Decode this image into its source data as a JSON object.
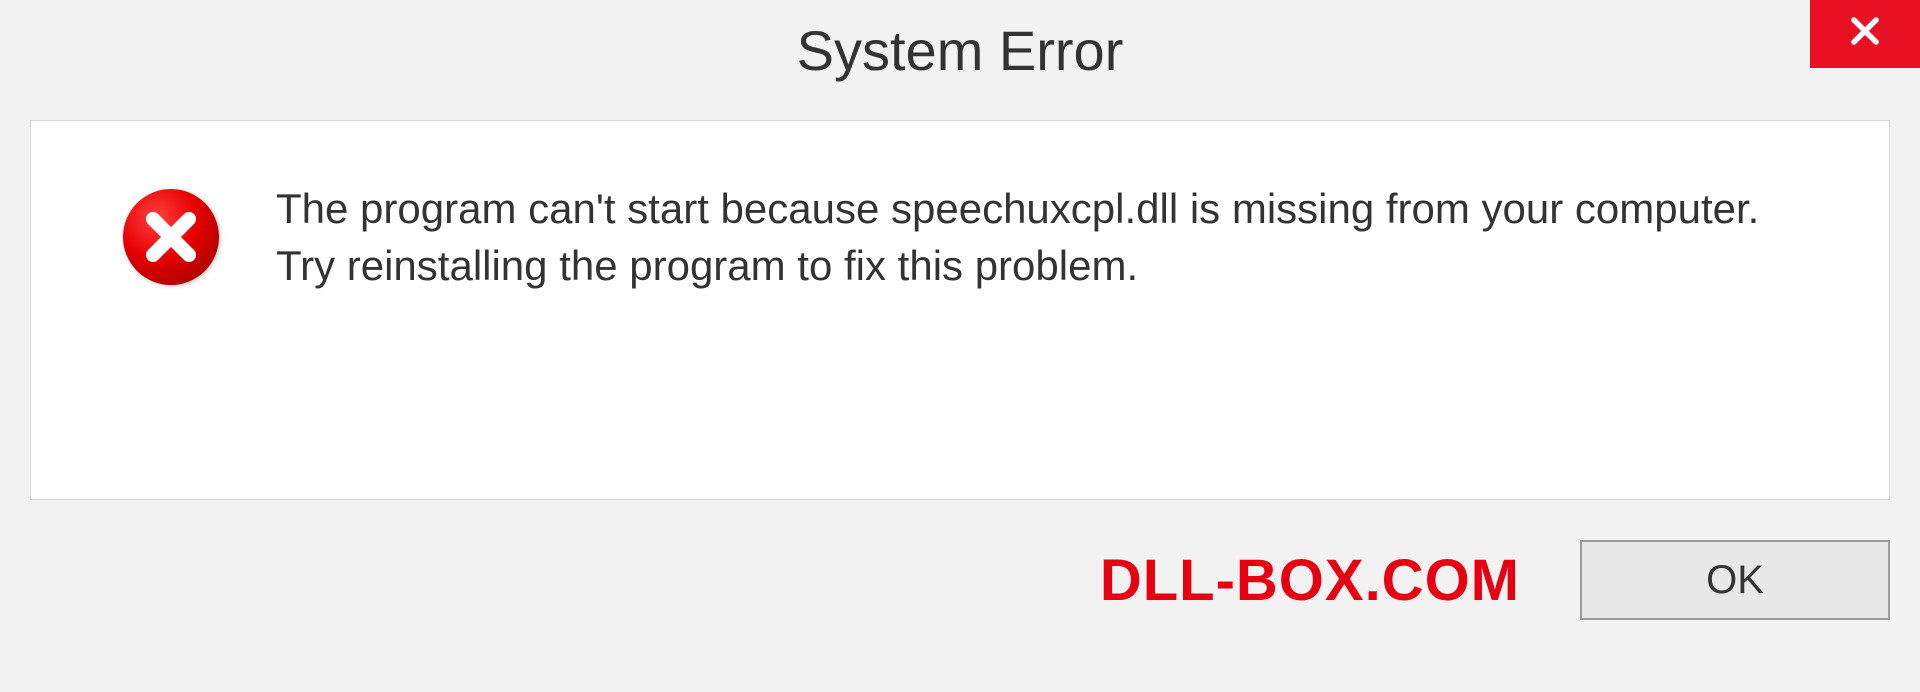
{
  "titlebar": {
    "title": "System Error"
  },
  "dialog": {
    "message": "The program can't start because speechuxcpl.dll is missing from your computer. Try reinstalling the program to fix this problem."
  },
  "footer": {
    "watermark": "DLL-BOX.COM",
    "ok_label": "OK"
  }
}
